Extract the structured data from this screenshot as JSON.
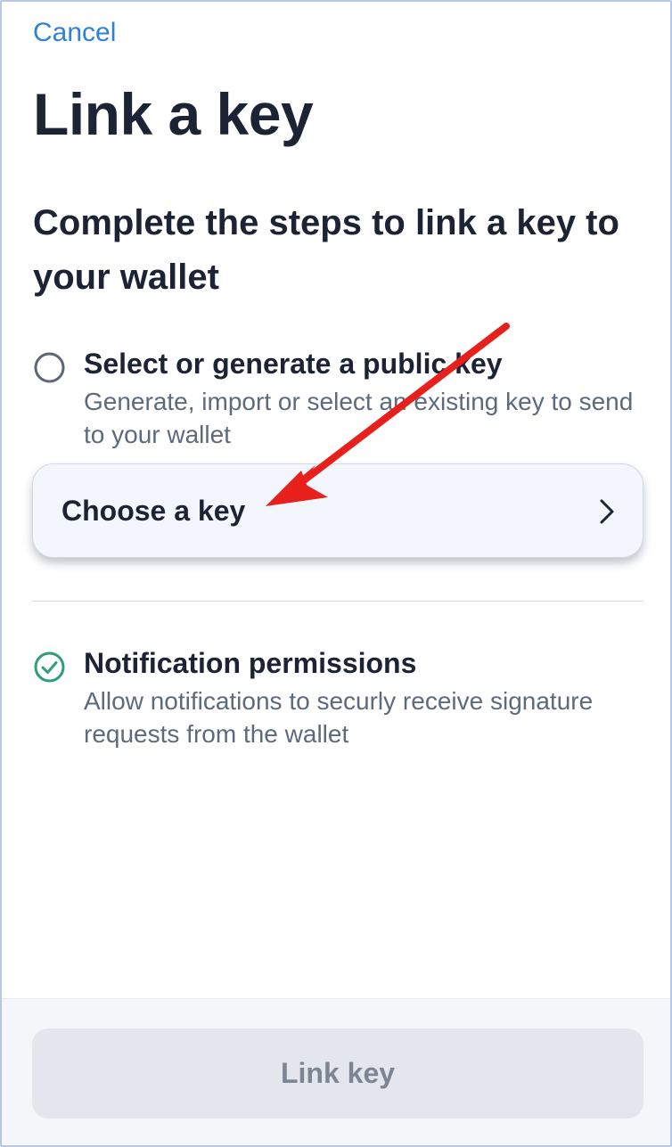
{
  "nav": {
    "cancel_label": "Cancel"
  },
  "page": {
    "title": "Link a key",
    "subtitle": "Complete the steps to link a key to your wallet"
  },
  "steps": [
    {
      "title": "Select or generate a public key",
      "description": "Generate, import or select an existing key to send to your wallet",
      "status": "incomplete",
      "icon": "empty-circle-icon"
    },
    {
      "title": "Notification permissions",
      "description": "Allow notifications to securly receive signature requests from the wallet",
      "status": "complete",
      "icon": "check-circle-icon"
    }
  ],
  "choose_key": {
    "label": "Choose a key",
    "icon": "chevron-right-icon"
  },
  "footer": {
    "link_key_label": "Link key",
    "disabled": true
  },
  "annotation": {
    "icon": "red-arrow-icon",
    "color": "#e8201c"
  },
  "colors": {
    "accent": "#2f80d8",
    "heading": "#1b2334",
    "muted_text": "#5d6a7e",
    "success": "#2f9e7c",
    "button_disabled_bg": "#e3e6ec"
  }
}
